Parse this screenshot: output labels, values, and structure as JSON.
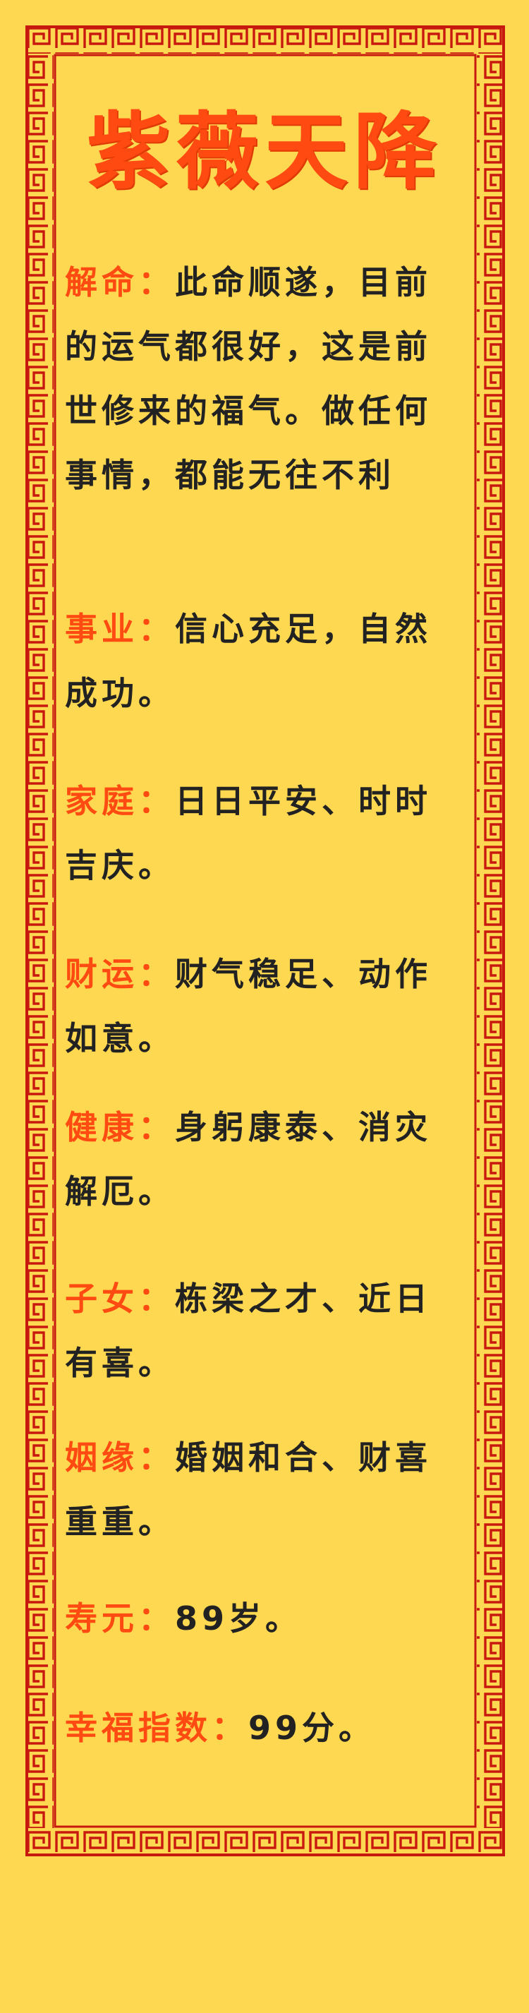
{
  "title": "紫薇天降",
  "sections": [
    {
      "label": "解命：",
      "text": "此命顺遂，目前的运气都很好，这是前世修来的福气。做任何事情，都能无往不利"
    },
    {
      "label": "事业：",
      "text": "信心充足，自然成功。"
    },
    {
      "label": "家庭：",
      "text": "日日平安、时时吉庆。"
    },
    {
      "label": "财运：",
      "text": "财气稳足、动作如意。"
    },
    {
      "label": "健康：",
      "text": "身躬康泰、消灾解厄。"
    },
    {
      "label": "子女：",
      "text": "栋梁之才、近日有喜。"
    },
    {
      "label": "姻缘：",
      "text": "婚姻和合、财喜重重。"
    },
    {
      "label": "寿元：",
      "text": "89岁。"
    },
    {
      "label": "幸福指数：",
      "text": "99分。"
    }
  ],
  "colors": {
    "background": "#fed851",
    "accent": "#ff4b12",
    "border": "#c8190f",
    "text": "#222222"
  }
}
